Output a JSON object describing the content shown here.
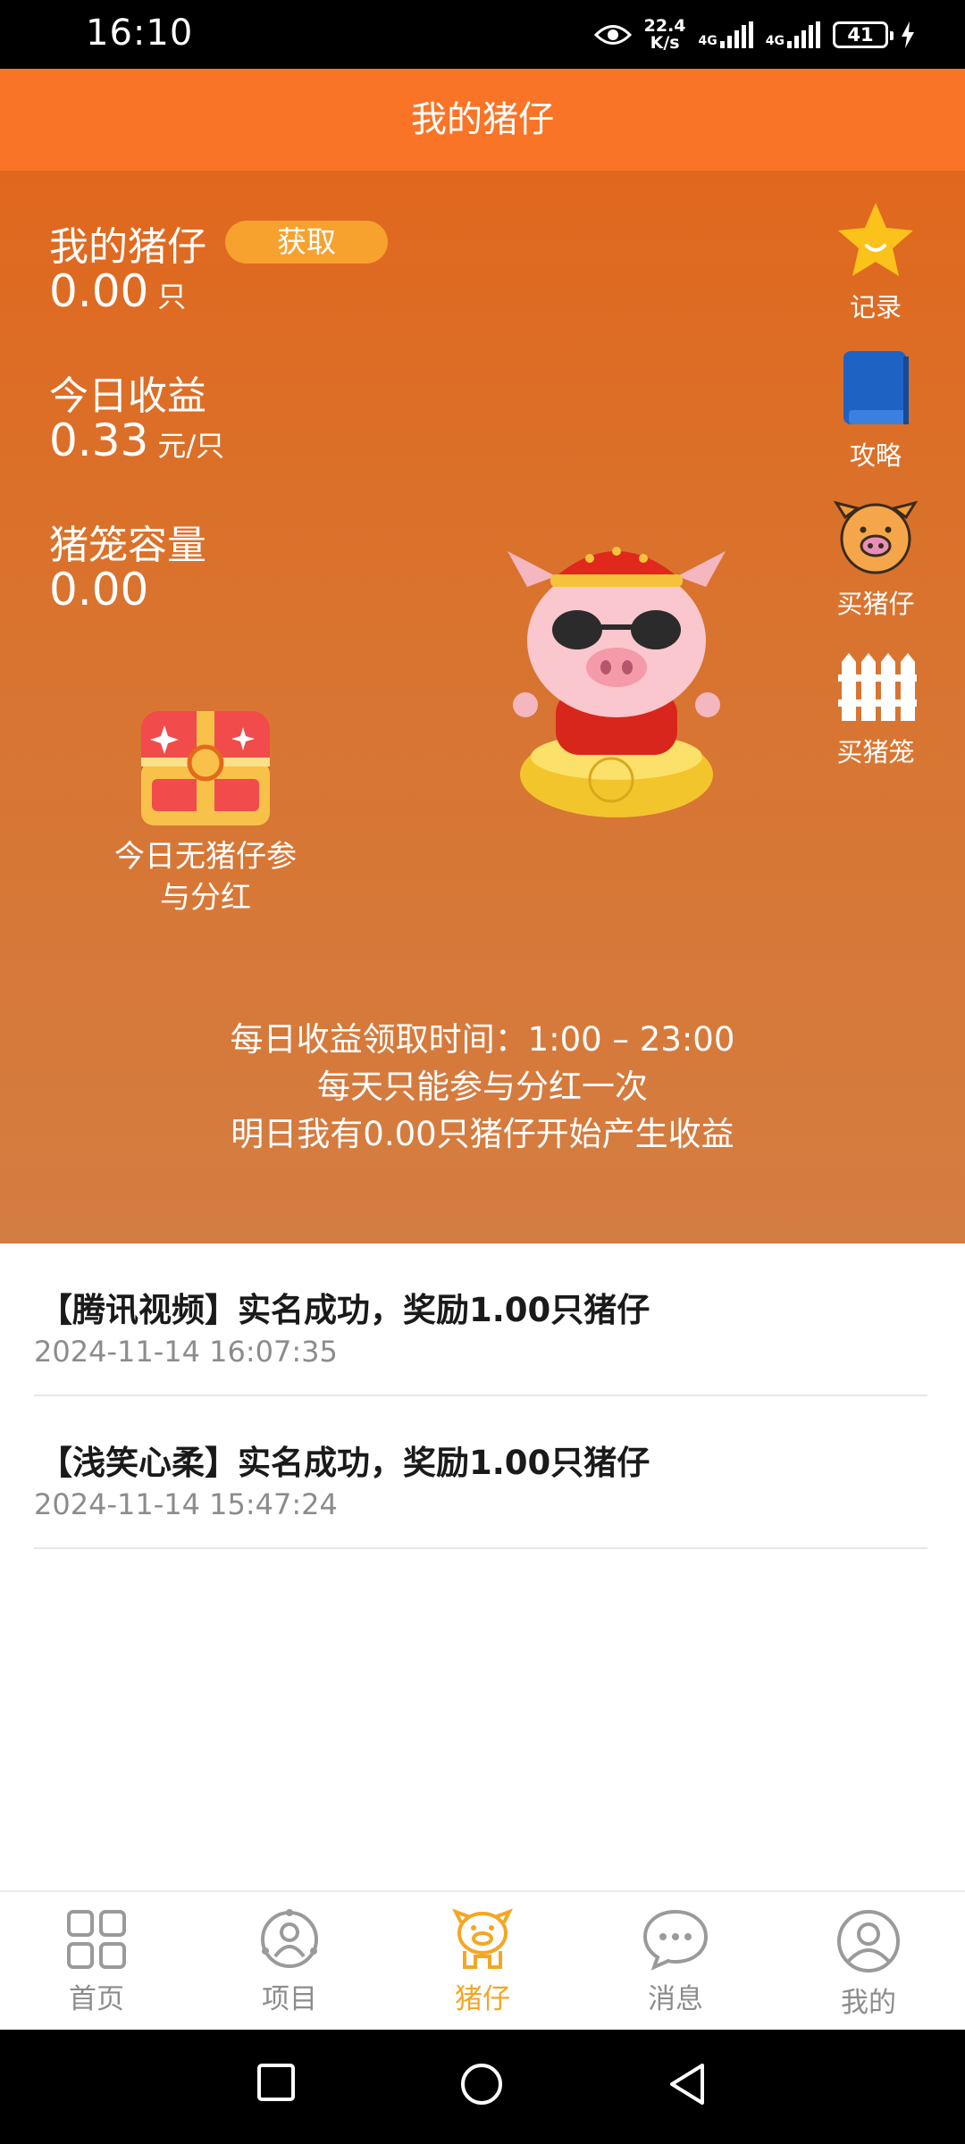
{
  "status": {
    "time": "16:10",
    "net_speed_value": "22.4",
    "net_speed_unit": "K/s",
    "sim1": "4G",
    "sim2": "4G",
    "battery": "41"
  },
  "header": {
    "title": "我的猪仔"
  },
  "stats": {
    "pigs_label": "我的猪仔",
    "get_button": "获取",
    "pigs_value": "0.00",
    "pigs_unit": "只",
    "today_label": "今日收益",
    "today_value": "0.33",
    "today_unit": "元/只",
    "capacity_label": "猪笼容量",
    "capacity_value": "0.00"
  },
  "side_menu": [
    {
      "label": "记录",
      "icon": "star-icon"
    },
    {
      "label": "攻略",
      "icon": "book-icon"
    },
    {
      "label": "买猪仔",
      "icon": "pig-face-icon"
    },
    {
      "label": "买猪笼",
      "icon": "fence-icon"
    }
  ],
  "chest": {
    "text_line1": "今日无猪仔参",
    "text_line2": "与分红"
  },
  "notice": {
    "line1": "每日收益领取时间：1:00 – 23:00",
    "line2": "每天只能参与分红一次",
    "line3": "明日我有0.00只猪仔开始产生收益"
  },
  "feed": [
    {
      "title": "【腾讯视频】实名成功，奖励1.00只猪仔",
      "time": "2024-11-14 16:07:35"
    },
    {
      "title": "【浅笑心柔】实名成功，奖励1.00只猪仔",
      "time": "2024-11-14 15:47:24"
    }
  ],
  "tabs": [
    {
      "label": "首页",
      "icon": "grid-icon"
    },
    {
      "label": "项目",
      "icon": "people-icon"
    },
    {
      "label": "猪仔",
      "icon": "pig-icon",
      "active": true
    },
    {
      "label": "消息",
      "icon": "chat-icon"
    },
    {
      "label": "我的",
      "icon": "user-icon"
    }
  ],
  "colors": {
    "accent": "#f97426",
    "active_tab": "#f5a623",
    "hero_top": "#e2651a",
    "hero_bottom": "#d47d42"
  }
}
